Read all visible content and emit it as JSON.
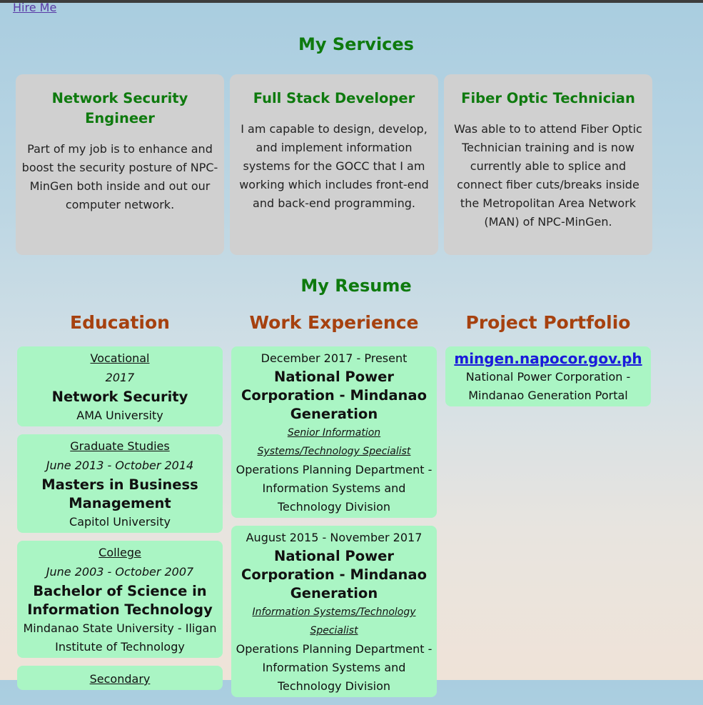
{
  "nav": {
    "hire_me": "Hire Me"
  },
  "services": {
    "heading": "My Services",
    "items": [
      {
        "title": "Network Security Engineer",
        "text": "Part of my job is to enhance and boost the security posture of NPC-MinGen both inside and out our computer network."
      },
      {
        "title": "Full Stack Developer",
        "text": "I am capable to design, develop, and implement information systems for the GOCC that I am working which includes front-end and back-end programming."
      },
      {
        "title": "Fiber Optic Technician",
        "text": "Was able to to attend Fiber Optic Technician training and is now currently able to splice and connect fiber cuts/breaks inside the Metropolitan Area Network (MAN) of NPC-MinGen."
      }
    ]
  },
  "resume": {
    "heading": "My Resume",
    "education": {
      "heading": "Education",
      "items": [
        {
          "level": "Vocational",
          "period": "2017",
          "title": "Network Security",
          "school": "AMA University"
        },
        {
          "level": "Graduate Studies",
          "period": "June 2013 - October 2014",
          "title": "Masters in Business Management",
          "school": "Capitol University"
        },
        {
          "level": "College",
          "period": "June 2003 - October 2007",
          "title": "Bachelor of Science in Information Technology",
          "school": "Mindanao State University - Iligan Institute of Technology"
        },
        {
          "level": "Secondary",
          "period": "",
          "title": "",
          "school": ""
        }
      ]
    },
    "work": {
      "heading": "Work Experience",
      "items": [
        {
          "period": "December 2017 - Present",
          "company": "National Power Corporation - Mindanao Generation",
          "position": "Senior Information Systems/Technology Specialist",
          "department": "Operations Planning Department - Information Systems and Technology Division"
        },
        {
          "period": "August 2015 - November 2017",
          "company": "National Power Corporation - Mindanao Generation",
          "position": "Information Systems/Technology Specialist",
          "department": "Operations Planning Department - Information Systems and Technology Division"
        }
      ]
    },
    "portfolio": {
      "heading": "Project Portfolio",
      "items": [
        {
          "link": "mingen.napocor.gov.ph",
          "description": "National Power Corporation - Mindanao Generation Portal"
        }
      ]
    }
  }
}
